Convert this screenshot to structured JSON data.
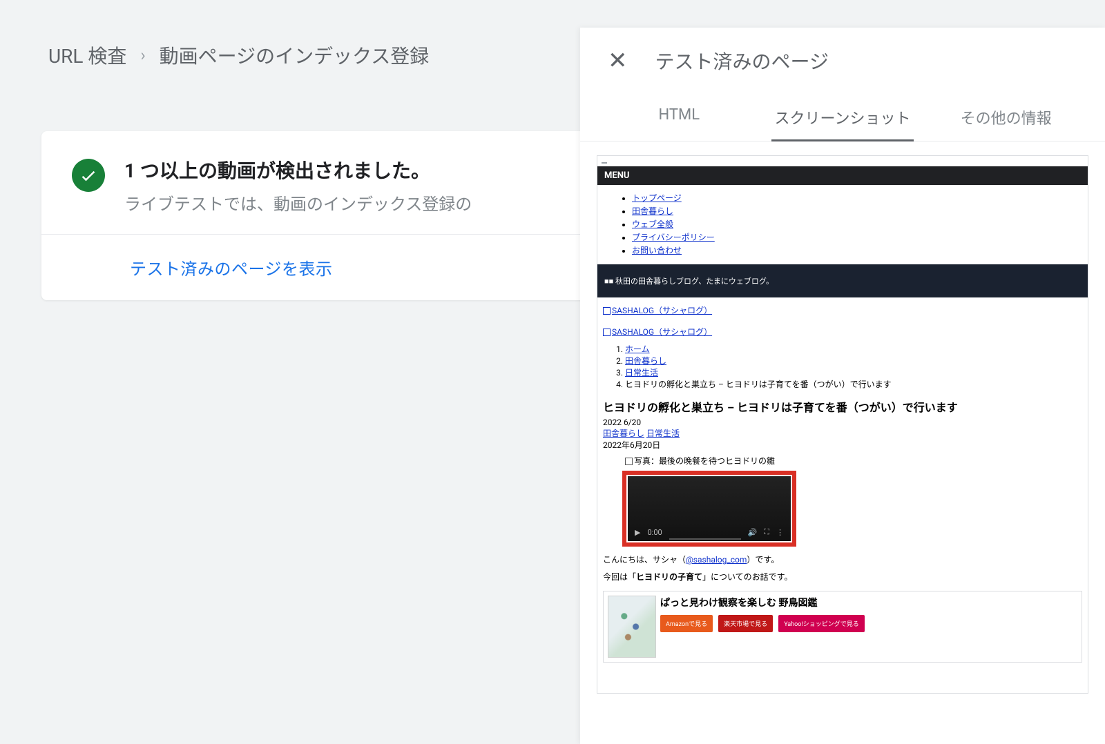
{
  "breadcrumb": {
    "item1": "URL 検査",
    "item2": "動画ページのインデックス登録"
  },
  "status": {
    "title": "1 つ以上の動画が検出されました。",
    "subtitle": "ライブテストでは、動画のインデックス登録の"
  },
  "action": {
    "view_tested": "テスト済みのページを表示"
  },
  "panel": {
    "title": "テスト済みのページ",
    "tabs": {
      "html": "HTML",
      "screenshot": "スクリーンショット",
      "other": "その他の情報"
    }
  },
  "preview": {
    "menu_small": "  ",
    "menu_label": "MENU",
    "nav": [
      "トップページ",
      "田舎暮らし",
      "ウェブ全般",
      "プライバシーポリシー",
      "お問い合わせ"
    ],
    "banner_text": "■■ 秋田の田舎暮らしブログ、たまにウェブログ。",
    "sitelink": "SASHALOG（サシャログ）",
    "breadcrumb_list": [
      "ホーム",
      "田舎暮らし",
      "日常生活",
      "ヒヨドリの孵化と巣立ち – ヒヨドリは子育てを番（つがい）で行います"
    ],
    "article_title": "ヒヨドリの孵化と巣立ち – ヒヨドリは子育てを番（つがい）で行います",
    "date_short": "2022 6/20",
    "cat1": "田舎暮らし",
    "cat2": "日常生活",
    "date_full": "2022年6月20日",
    "photo_caption": "写真：最後の晩餐を待つヒヨドリの雛",
    "video_time": "0:00",
    "intro_pre": "こんにちは、サシャ（",
    "intro_link": "@sashalog_com",
    "intro_post": "）です。",
    "topic_pre": "今回は「",
    "topic_bold": "ヒヨドリの子育て",
    "topic_post": "」についてのお話です。",
    "book_title": "ぱっと見わけ観察を楽しむ 野鳥図鑑",
    "buy_amazon": "Amazonで見る",
    "buy_rakuten": "楽天市場で見る",
    "buy_yahoo": "Yahoo!ショッピングで見る"
  }
}
